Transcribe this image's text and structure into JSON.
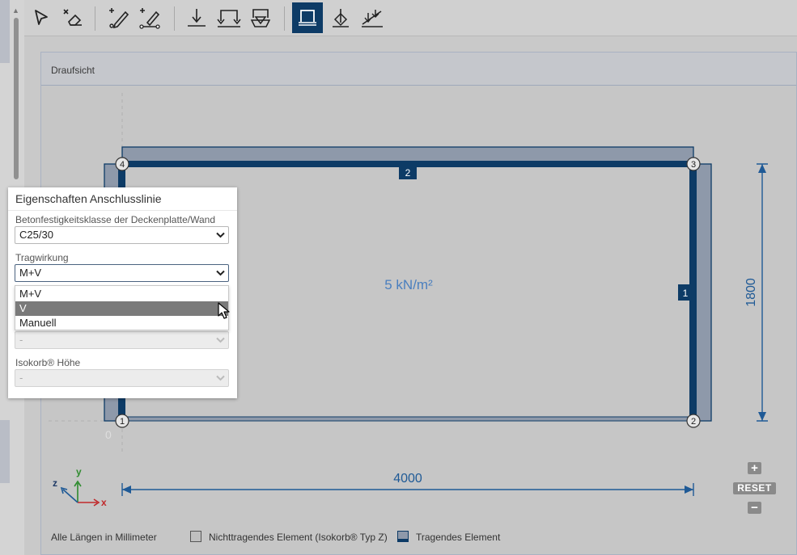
{
  "toolbar": {
    "tools": [
      {
        "name": "select-cursor-icon"
      },
      {
        "name": "eraser-icon"
      },
      {
        "name": "draw-line-icon"
      },
      {
        "name": "draw-polyline-icon"
      },
      {
        "name": "point-support-icon"
      },
      {
        "name": "line-support-icon"
      },
      {
        "name": "area-support-icon"
      },
      {
        "name": "connection-line-icon"
      },
      {
        "name": "point-load-icon"
      },
      {
        "name": "line-load-icon"
      }
    ],
    "active_tool": "connection-line-icon"
  },
  "panel": {
    "title": "Draufsicht"
  },
  "drawing": {
    "load_label": "5 kN/m²",
    "dimension_width": "4000",
    "dimension_height": "1800",
    "origin_label": "0",
    "nodes": [
      "1",
      "2",
      "3",
      "4"
    ],
    "edge_labels": [
      "1",
      "2"
    ],
    "axes": {
      "x": "x",
      "y": "y",
      "z": "z"
    },
    "colors": {
      "structure": "#0d3b66",
      "nonbearing": "#8e99aa",
      "dimension": "#1f5a96",
      "load_text": "#4a7fbf"
    }
  },
  "legend": {
    "units": "Alle Längen in Millimeter",
    "nonbearing": "Nichttragendes Element (Isokorb® Typ Z)",
    "bearing": "Tragendes Element"
  },
  "zoom": {
    "plus": "+",
    "reset": "RESET",
    "minus": "−"
  },
  "properties": {
    "title": "Eigenschaften Anschlusslinie",
    "concrete_label": "Betonfestigkeitsklasse der Deckenplatte/Wand",
    "concrete_value": "C25/30",
    "action_label": "Tragwirkung",
    "action_value": "M+V",
    "action_options": [
      "M+V",
      "V",
      "Manuell"
    ],
    "highlighted_option": "V",
    "hidden_value": "-",
    "height_label": "Isokorb® Höhe",
    "height_value": "-"
  }
}
